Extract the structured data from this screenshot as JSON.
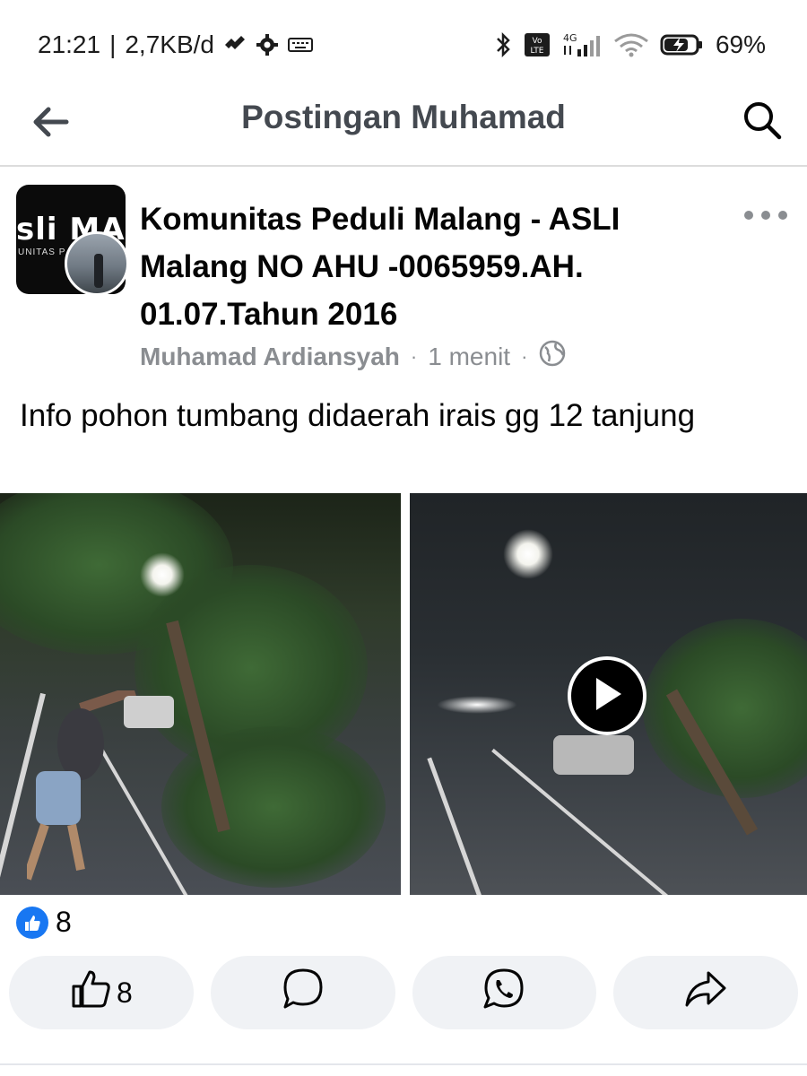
{
  "status_bar": {
    "time": "21:21",
    "separator": "|",
    "speed": "2,7KB/d",
    "network_type": "4G",
    "volte": "Vo LTE",
    "battery": "69%"
  },
  "header": {
    "title": "Postingan Muhamad"
  },
  "post": {
    "group_name": "Komunitas Peduli Malang - ASLI Malang  NO AHU -0065959.AH. 01.07.Tahun 2016",
    "avatar_logo_left": "sli ",
    "avatar_logo_mid": "MA",
    "avatar_logo_right": "AN",
    "avatar_sub": "UNITAS P",
    "author": "Muhamad Ardiansyah",
    "time_ago": "1 menit",
    "text": "Info pohon tumbang didaerah irais gg 12 tanjung",
    "reaction_count": "8"
  },
  "actions": {
    "like_count": "8"
  },
  "icons": {
    "back": "arrow-left-icon",
    "search": "search-icon",
    "more": "more-icon",
    "globe": "globe-icon",
    "like": "thumbs-up-icon",
    "comment": "comment-icon",
    "whatsapp": "whatsapp-icon",
    "share": "share-icon",
    "play": "play-icon"
  },
  "colors": {
    "accent": "#1877f2",
    "muted_text": "#8a8d91",
    "button_bg": "#f0f2f5"
  }
}
